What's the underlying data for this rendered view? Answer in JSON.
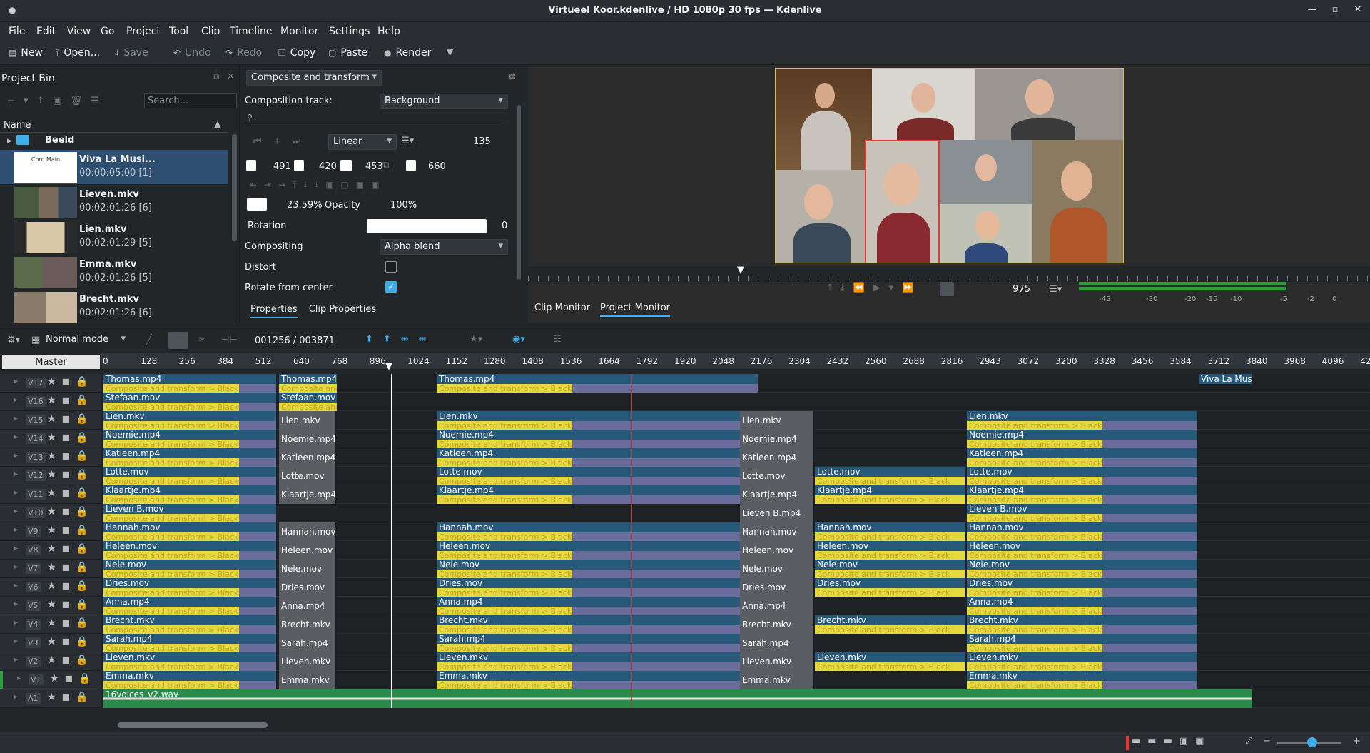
{
  "window": {
    "title": "Virtueel Koor.kdenlive / HD 1080p 30 fps — Kdenlive"
  },
  "menu": [
    "File",
    "Edit",
    "View",
    "Go",
    "Project",
    "Tool",
    "Clip",
    "Timeline",
    "Monitor",
    "Settings",
    "Help"
  ],
  "toolbar": {
    "new": "New",
    "open": "Open...",
    "save": "Save",
    "undo": "Undo",
    "redo": "Redo",
    "copy": "Copy",
    "paste": "Paste",
    "render": "Render"
  },
  "bin": {
    "title": "Project Bin",
    "search_placeholder": "Search...",
    "column_name": "Name",
    "folder": "Beeld",
    "items": [
      {
        "name": "Viva La Musi...",
        "sub": "00:00:05:00 [1]"
      },
      {
        "name": "Lieven.mkv",
        "sub": "00:02:01:26 [6]"
      },
      {
        "name": "Lien.mkv",
        "sub": "00:02:01:29 [5]"
      },
      {
        "name": "Emma.mkv",
        "sub": "00:02:01:26 [5]"
      },
      {
        "name": "Brecht.mkv",
        "sub": "00:02:01:26 [6]"
      }
    ],
    "thumb_text": "Coro Main"
  },
  "effect": {
    "name": "Composite and transform",
    "composition_track_label": "Composition track:",
    "composition_track_value": "Background",
    "interpolation": "Linear",
    "frame": "135",
    "x": "491",
    "y": "420",
    "w": "453",
    "h": "660",
    "size": "23.59%",
    "opacity_label": "Opacity",
    "opacity": "100%",
    "rotation_label": "Rotation",
    "rotation": "0",
    "compositing_label": "Compositing",
    "compositing_value": "Alpha blend",
    "distort_label": "Distort",
    "rotate_center_label": "Rotate from center",
    "tab_properties": "Properties",
    "tab_clip_properties": "Clip Properties"
  },
  "monitor": {
    "frame": "975",
    "tab_clip": "Clip Monitor",
    "tab_project": "Project Monitor",
    "vu_labels": [
      "-45",
      "-30",
      "-20",
      "-15",
      "-10",
      "-5",
      "-2",
      "0"
    ]
  },
  "timeline_toolbar": {
    "mode": "Normal mode",
    "timecode": "001256 / 003871"
  },
  "timeline": {
    "master": "Master",
    "ruler": [
      "0",
      "128",
      "256",
      "384",
      "512",
      "640",
      "768",
      "896",
      "1024",
      "1152",
      "1280",
      "1408",
      "1536",
      "1664",
      "1792",
      "1920",
      "2048",
      "2176",
      "2304",
      "2432",
      "2560",
      "2688",
      "2816",
      "2943",
      "3072",
      "3200",
      "3328",
      "3456",
      "3584",
      "3712",
      "3840",
      "3968",
      "4096",
      "42"
    ],
    "comp_label": "Composite and transform > Black",
    "comp_short": "Composite and tr",
    "tracks": [
      {
        "name": "V17",
        "a": "Thomas.mp4",
        "b": "Thomas.mp4",
        "c": "Thomas.mp4",
        "d": "Viva La Musi"
      },
      {
        "name": "V16",
        "a": "Stefaan.mov",
        "b": "Stefaan.mov"
      },
      {
        "name": "V15",
        "a": "Lien.mkv",
        "b": "Lien.mkv",
        "c": "Lien.mkv",
        "e": "Lien.mkv",
        "f": "Lien.mkv"
      },
      {
        "name": "V14",
        "a": "Noemie.mp4",
        "b": "Noemie.mp4",
        "c": "Noemie.mp4",
        "e": "Noemie.mp4",
        "f": "Noemie.mp4"
      },
      {
        "name": "V13",
        "a": "Katleen.mp4",
        "b": "Katleen.mp4",
        "c": "Katleen.mp4",
        "e": "Katleen.mp4",
        "f": "Katleen.mp4"
      },
      {
        "name": "V12",
        "a": "Lotte.mov",
        "b": "Lotte.mov",
        "c": "Lotte.mov",
        "e": "Lotte.mov",
        "f": "Lotte.mov",
        "g": "Lotte.mov"
      },
      {
        "name": "V11",
        "a": "Klaartje.mp4",
        "b": "Klaartje.mp4",
        "c": "Klaartje.mp4",
        "e": "Klaartje.mp4",
        "f": "Klaartje.mp4",
        "g": "Klaartje.mp4"
      },
      {
        "name": "V10",
        "a": "Lieven B.mov",
        "e": "Lieven B.mp4",
        "f": "Lieven B.mov"
      },
      {
        "name": "V9",
        "a": "Hannah.mov",
        "b": "Hannah.mov",
        "c": "Hannah.mov",
        "e": "Hannah.mov",
        "f": "Hannah.mov",
        "g": "Hannah.mov"
      },
      {
        "name": "V8",
        "a": "Heleen.mov",
        "b": "Heleen.mov",
        "c": "Heleen.mov",
        "e": "Heleen.mov",
        "f": "Heleen.mov",
        "g": "Heleen.mov"
      },
      {
        "name": "V7",
        "a": "Nele.mov",
        "b": "Nele.mov",
        "c": "Nele.mov",
        "e": "Nele.mov",
        "f": "Nele.mov",
        "g": "Nele.mov"
      },
      {
        "name": "V6",
        "a": "Dries.mov",
        "b": "Dries.mov",
        "c": "Dries.mov",
        "e": "Dries.mov",
        "f": "Dries.mov",
        "g": "Dries.mov"
      },
      {
        "name": "V5",
        "a": "Anna.mp4",
        "b": "Anna.mp4",
        "c": "Anna.mp4",
        "e": "Anna.mp4",
        "f": "Anna.mp4"
      },
      {
        "name": "V4",
        "a": "Brecht.mkv",
        "b": "Brecht.mkv",
        "c": "Brecht.mkv",
        "e": "Brecht.mkv",
        "f": "Brecht.mkv",
        "g": "Brecht.mkv"
      },
      {
        "name": "V3",
        "a": "Sarah.mp4",
        "b": "Sarah.mp4",
        "c": "Sarah.mp4",
        "e": "Sarah.mp4",
        "f": "Sarah.mp4"
      },
      {
        "name": "V2",
        "a": "Lieven.mkv",
        "b": "Lieven.mkv",
        "c": "Lieven.mkv",
        "e": "Lieven.mkv",
        "f": "Lieven.mkv",
        "g": "Lieven.mkv"
      },
      {
        "name": "V1",
        "a": "Emma.mkv",
        "b": "Emma.mkv",
        "c": "Emma.mkv",
        "e": "Emma.mkv",
        "f": "Emma.mkv"
      },
      {
        "name": "A1",
        "a": "16voices_v2.wav"
      }
    ]
  }
}
